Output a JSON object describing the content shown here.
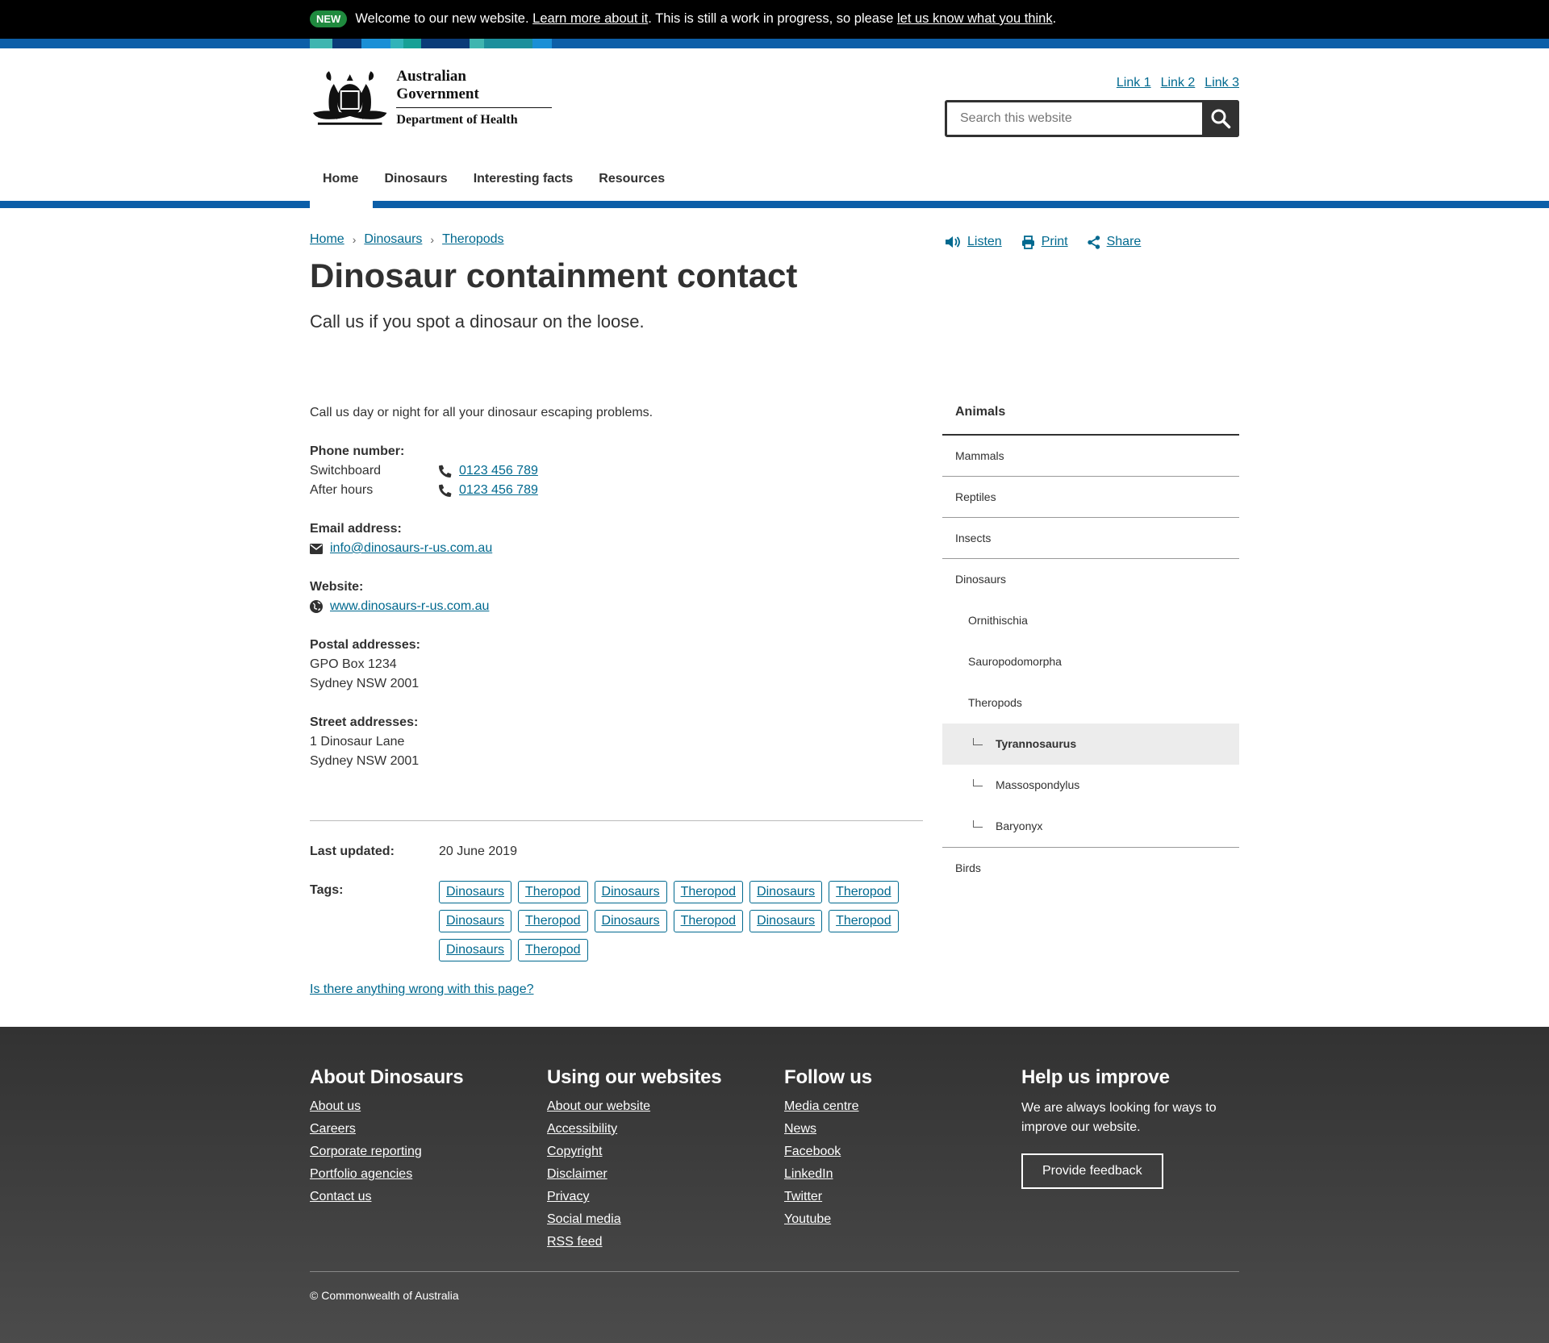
{
  "banner": {
    "badge": "NEW",
    "text1": "Welcome to our new website.",
    "link1": "Learn more about it",
    "text2": ". This is still a work in progress, so please",
    "link2": "let us know what you think",
    "text3": "."
  },
  "header": {
    "logo_line1": "Australian Government",
    "logo_line2": "Department of Health",
    "quick_links": [
      "Link 1",
      "Link 2",
      "Link 3"
    ],
    "search_placeholder": "Search this website"
  },
  "nav": [
    "Home",
    "Dinosaurs",
    "Interesting facts",
    "Resources"
  ],
  "breadcrumb": [
    "Home",
    "Dinosaurs",
    "Theropods"
  ],
  "actions": {
    "listen": "Listen",
    "print": "Print",
    "share": "Share"
  },
  "page": {
    "title": "Dinosaur containment contact",
    "lead": "Call us if you spot a dinosaur on the loose.",
    "intro": "Call us day or night for all your dinosaur escaping problems."
  },
  "contact": {
    "phone_label": "Phone number:",
    "phones": [
      {
        "label": "Switchboard",
        "number": "0123 456 789"
      },
      {
        "label": "After hours",
        "number": "0123 456 789"
      }
    ],
    "email_label": "Email address:",
    "email": "info@dinosaurs-r-us.com.au",
    "website_label": "Website:",
    "website": "www.dinosaurs-r-us.com.au",
    "postal_label": "Postal addresses:",
    "postal": [
      "GPO Box 1234",
      "Sydney NSW 2001"
    ],
    "street_label": "Street addresses:",
    "street": [
      "1 Dinosaur Lane",
      "Sydney NSW 2001"
    ]
  },
  "meta": {
    "updated_label": "Last updated:",
    "updated": "20 June 2019",
    "tags_label": "Tags:",
    "tags": [
      "Dinosaurs",
      "Theropod",
      "Dinosaurs",
      "Theropod",
      "Dinosaurs",
      "Theropod",
      "Dinosaurs",
      "Theropod",
      "Dinosaurs",
      "Theropod",
      "Dinosaurs",
      "Theropod",
      "Dinosaurs",
      "Theropod"
    ],
    "report": "Is there anything wrong with this page?"
  },
  "sidenav": {
    "heading": "Animals",
    "items": [
      "Mammals",
      "Reptiles",
      "Insects"
    ],
    "dinosaurs": "Dinosaurs",
    "dino_subs": [
      "Ornithischia",
      "Sauropodomorpha",
      "Theropods"
    ],
    "theropod_subs": [
      "Tyrannosaurus",
      "Massospondylus",
      "Baryonyx"
    ],
    "last": "Birds"
  },
  "footer": {
    "about": {
      "title": "About Dinosaurs",
      "links": [
        "About us",
        "Careers",
        "Corporate reporting",
        "Portfolio agencies",
        "Contact us"
      ]
    },
    "using": {
      "title": "Using our websites",
      "links": [
        "About our website",
        "Accessibility",
        "Copyright",
        "Disclaimer",
        "Privacy",
        "Social media",
        "RSS feed"
      ]
    },
    "follow": {
      "title": "Follow us",
      "links": [
        "Media centre",
        "News",
        "Facebook",
        "LinkedIn",
        "Twitter",
        "Youtube"
      ]
    },
    "help": {
      "title": "Help us improve",
      "text": "We are always looking for ways to improve our website.",
      "button": "Provide feedback"
    },
    "copyright": "© Commonwealth of Australia"
  },
  "colors": {
    "primary": "#0c5ea8",
    "link": "#00698f",
    "badge": "#1f8a3e",
    "text": "#313131"
  }
}
